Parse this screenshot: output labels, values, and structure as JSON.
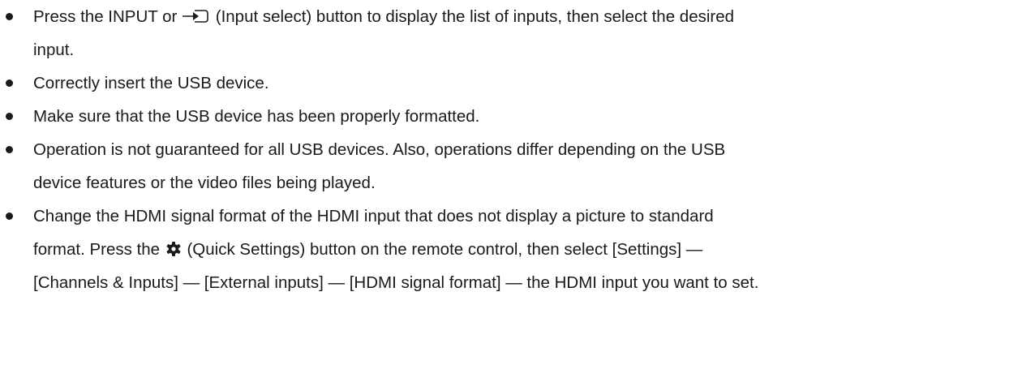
{
  "items": [
    {
      "lines": [
        {
          "before": "Press the INPUT or ",
          "icon": "input-select-icon",
          "after": " (Input select) button to display the list of inputs, then select the desired"
        },
        {
          "text": "input."
        }
      ]
    },
    {
      "lines": [
        {
          "text": "Correctly insert the USB device."
        }
      ]
    },
    {
      "lines": [
        {
          "text": "Make sure that the USB device has been properly formatted."
        }
      ]
    },
    {
      "lines": [
        {
          "text": "Operation is not guaranteed for all USB devices. Also, operations differ depending on the USB"
        },
        {
          "text": "device features or the video files being played."
        }
      ]
    },
    {
      "lines": [
        {
          "text": "Change the HDMI signal format of the HDMI input that does not display a picture to standard"
        },
        {
          "before": "format. Press the ",
          "icon": "gear-icon",
          "after": " (Quick Settings) button on the remote control, then select [Settings] —"
        },
        {
          "text": "[Channels & Inputs] — [External inputs] — [HDMI signal format] — the HDMI input you want to set."
        }
      ]
    }
  ]
}
